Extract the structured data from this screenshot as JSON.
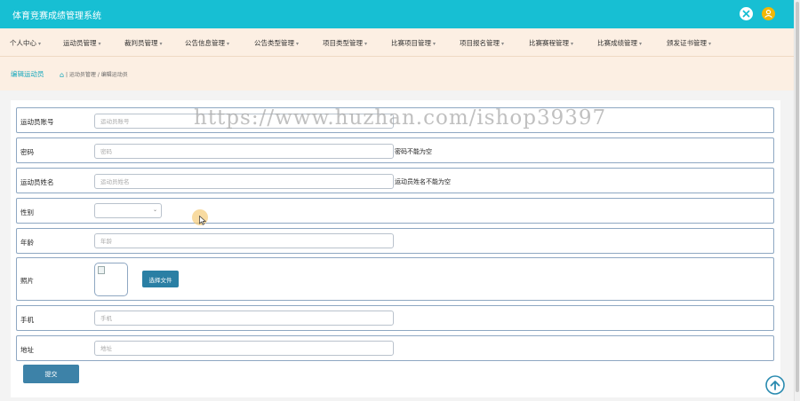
{
  "header": {
    "app_title": "体育竞赛成绩管理系统",
    "icons": [
      "close-icon",
      "user-icon"
    ]
  },
  "nav": {
    "items": [
      {
        "label": "个人中心"
      },
      {
        "label": "运动员管理"
      },
      {
        "label": "裁判员管理"
      },
      {
        "label": "公告信息管理"
      },
      {
        "label": "公告类型管理"
      },
      {
        "label": "项目类型管理"
      },
      {
        "label": "比赛项目管理"
      },
      {
        "label": "项目报名管理"
      },
      {
        "label": "比赛赛程管理"
      },
      {
        "label": "比赛成绩管理"
      },
      {
        "label": "颁发证书管理"
      }
    ]
  },
  "breadcrumb": {
    "title": "编辑运动员",
    "path": "运动员管理 / 编辑运动员"
  },
  "form": {
    "account": {
      "label": "运动员账号",
      "placeholder": "运动员账号"
    },
    "password": {
      "label": "密码",
      "placeholder": "密码",
      "error": "密码不能为空"
    },
    "name": {
      "label": "运动员姓名",
      "placeholder": "运动员姓名",
      "error": "运动员姓名不能为空"
    },
    "gender": {
      "label": "性别",
      "value": ""
    },
    "age": {
      "label": "年龄",
      "placeholder": "年龄"
    },
    "photo": {
      "label": "照片",
      "button": "选择文件"
    },
    "phone": {
      "label": "手机",
      "placeholder": "手机"
    },
    "address": {
      "label": "地址",
      "placeholder": "地址"
    },
    "submit": "提交"
  },
  "watermark": "https://www.huzhan.com/ishop39397",
  "colors": {
    "header_bg": "#17bfd3",
    "nav_bg": "#fcefe3",
    "button_bg": "#2a7fa4",
    "row_border": "#8ea7c2",
    "accent_text": "#17a8bd"
  }
}
